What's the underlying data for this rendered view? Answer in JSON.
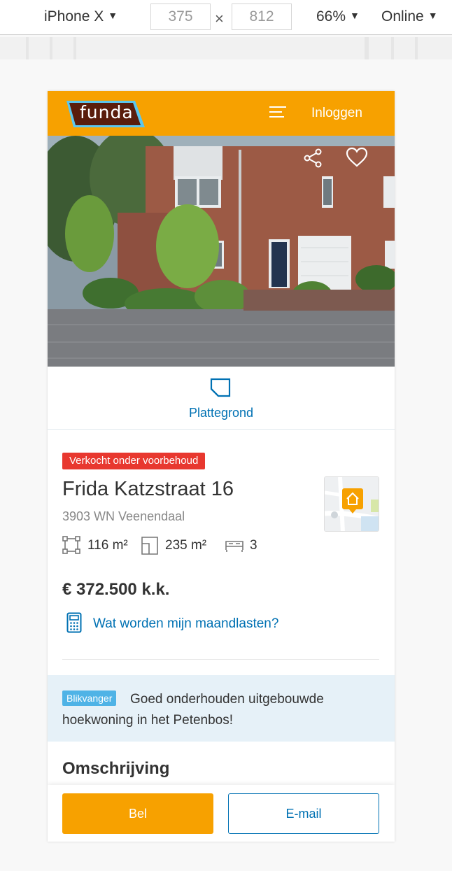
{
  "devtools": {
    "device": "iPhone X",
    "width": "375",
    "times": "×",
    "height": "812",
    "zoom": "66%",
    "network": "Online",
    "caret": "▼"
  },
  "header": {
    "brand": "funda",
    "login_label": "Inloggen",
    "brand_color": "#f7a100"
  },
  "hero": {
    "share_icon": "share-icon",
    "favorite_icon": "heart-icon"
  },
  "floorplan": {
    "label": "Plattegrond"
  },
  "listing": {
    "status": "Verkocht onder voorbehoud",
    "street": "Frida Katzstraat 16",
    "postcode_city": "3903 WN Veenendaal",
    "living_area": "116 m²",
    "plot_area": "235 m²",
    "bedrooms": "3",
    "price": "€ 372.500 k.k.",
    "monthly_link": "Wat worden mijn maandlasten?"
  },
  "catcher": {
    "badge": "Blikvanger",
    "text": "Goed onderhouden uitgebouwde hoekwoning in het Petenbos!"
  },
  "description": {
    "title": "Omschrijving"
  },
  "actions": {
    "call_label": "Bel",
    "email_label": "E-mail"
  }
}
